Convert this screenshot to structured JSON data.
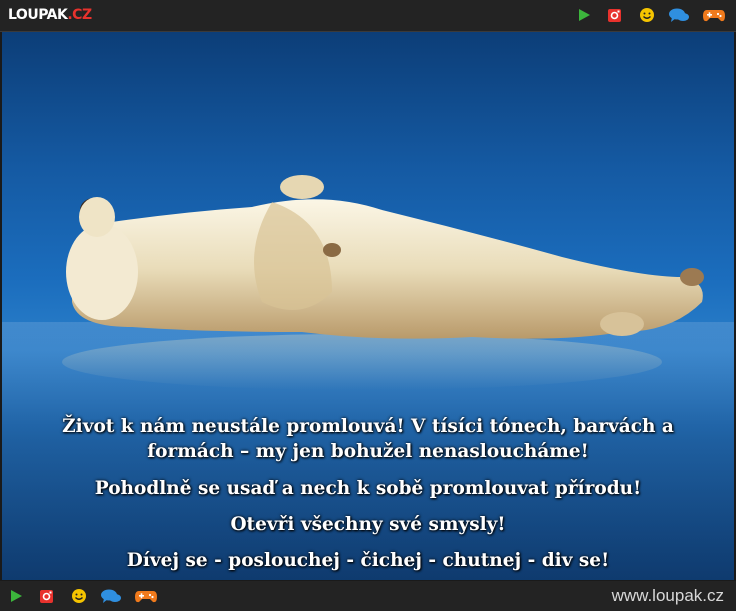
{
  "header": {
    "logo_part1": "LOUPAK",
    "logo_part2": ".CZ",
    "icons": [
      "play-icon",
      "instagram-icon",
      "smiley-icon",
      "chat-icon",
      "gamepad-icon"
    ]
  },
  "colors": {
    "play": "#3cb53c",
    "instagram": "#e8322d",
    "smiley": "#f5c400",
    "chat": "#2f8fe0",
    "gamepad": "#f07a1c"
  },
  "post": {
    "image_alt": "Polar bear lying on its back on the ice",
    "lines": [
      "Život k nám neustále promlouvá! V tísíci tónech, barvách a",
      "formách – my jen bohužel nenasloucháme!",
      "Pohodlně se usaď a nech k sobě promlouvat přírodu!",
      "Otevři všechny své smysly!",
      "Dívej se - poslouchej - čichej - chutnej - div se!"
    ]
  },
  "footer": {
    "site": "www.loupak.cz"
  }
}
